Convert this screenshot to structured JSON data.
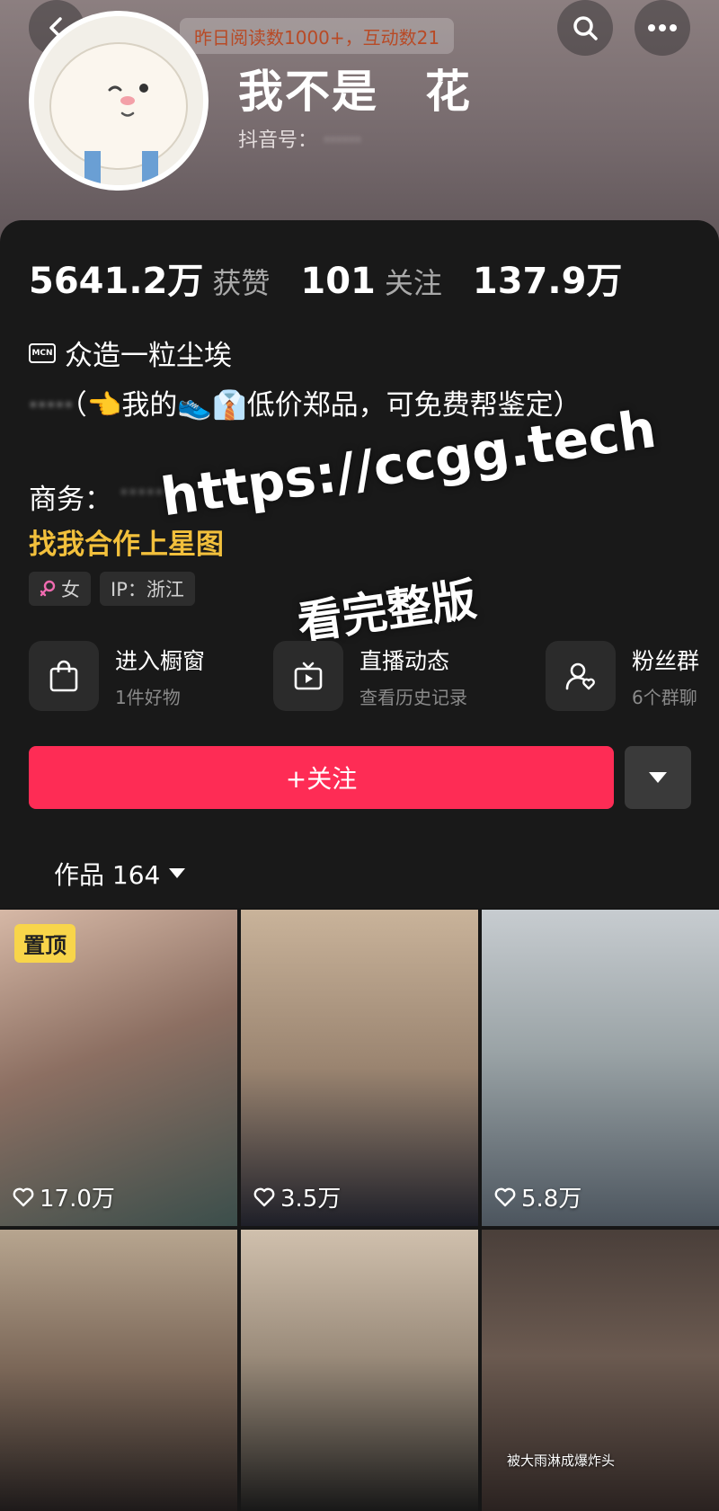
{
  "header": {
    "notice": "昨日阅读数1000+，互动数21",
    "nickname": "我不是　花",
    "douyin_id_label": "抖音号：",
    "douyin_id_value": "······"
  },
  "stats": [
    {
      "value": "5641.2万",
      "label": "获赞"
    },
    {
      "value": "101",
      "label": "关注"
    },
    {
      "value": "137.9万",
      "label": ""
    }
  ],
  "profile": {
    "mcn_badge": "MCN",
    "mcn_name": "众造一粒尘埃",
    "bio_hidden": "·····",
    "bio": "（👈我的👟👔低价郑品，可免费帮鉴定）",
    "biz_label": "商务：",
    "biz_value": "·······",
    "star_link": "找我合作上星图",
    "gender_tag": "女",
    "ip_tag": "IP：浙江"
  },
  "watermark": {
    "line1": "https://ccgg.tech",
    "line2": "看完整版"
  },
  "entries": [
    {
      "title": "进入橱窗",
      "sub": "1件好物",
      "icon": "shopping-bag-icon"
    },
    {
      "title": "直播动态",
      "sub": "查看历史记录",
      "icon": "tv-icon"
    },
    {
      "title": "粉丝群",
      "sub": "6个群聊",
      "icon": "fans-group-icon"
    }
  ],
  "follow_label": "+关注",
  "works": {
    "tab_label": "作品 164",
    "items": [
      {
        "likes": "17.0万",
        "pinned": "置顶",
        "caption": ""
      },
      {
        "likes": "3.5万",
        "pinned": "",
        "caption": ""
      },
      {
        "likes": "5.8万",
        "pinned": "",
        "caption": ""
      },
      {
        "likes": "",
        "pinned": "",
        "caption": ""
      },
      {
        "likes": "",
        "pinned": "",
        "caption": ""
      },
      {
        "likes": "",
        "pinned": "",
        "caption": "被大雨淋成爆炸头"
      }
    ]
  },
  "colors": {
    "accent": "#fe2c55",
    "star_link": "#f2c03c",
    "pin_badge": "#f8d54a",
    "notice_text": "#b84a26"
  }
}
